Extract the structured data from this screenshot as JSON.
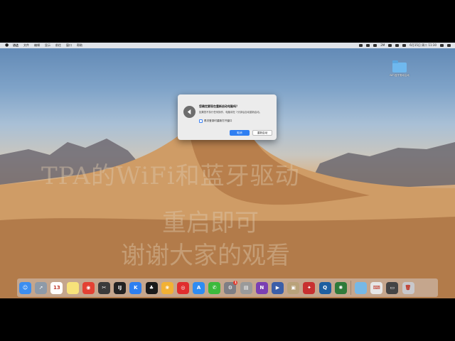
{
  "menubar": {
    "items": [
      "访达",
      "文件",
      "编辑",
      "显示",
      "前往",
      "窗口",
      "帮助"
    ],
    "status_text": [
      "2M",
      "6月15日 周二 11:30"
    ]
  },
  "desktop": {
    "folder_label": "WiFi蓝牙驱动启动"
  },
  "captions": {
    "line1": "TPA的WiFi和蓝牙驱动",
    "line2": "重启即可",
    "line3": "谢谢大家的观看"
  },
  "dialog": {
    "title": "您确定要现在重新启动电脑吗？",
    "message": "如果您不执行任何操作，电脑将在 7分钟后自动重新启动。",
    "checkbox_label": "再次登录时重新打开窗口",
    "primary_button": "取消",
    "secondary_button": "重新启动"
  },
  "dock": {
    "apps": [
      {
        "name": "finder-icon",
        "color": "#3c8ef0",
        "glyph": "☺"
      },
      {
        "name": "launchpad-icon",
        "color": "#8e9aa8",
        "glyph": "➚"
      },
      {
        "name": "calendar-icon",
        "color": "#ffffff",
        "glyph": "13"
      },
      {
        "name": "notes-icon",
        "color": "#f7e27a",
        "glyph": ""
      },
      {
        "name": "chrome-icon",
        "color": "#e34133",
        "glyph": "◉"
      },
      {
        "name": "final-cut-icon",
        "color": "#3a3a3a",
        "glyph": "✂"
      },
      {
        "name": "intellij-icon",
        "color": "#222222",
        "glyph": "IJ"
      },
      {
        "name": "kugou-icon",
        "color": "#2d7ff0",
        "glyph": "K"
      },
      {
        "name": "qq-icon",
        "color": "#1a1a1a",
        "glyph": "♣"
      },
      {
        "name": "photos-icon",
        "color": "#f2b134",
        "glyph": "❀"
      },
      {
        "name": "netease-music-icon",
        "color": "#e02d2d",
        "glyph": "◎"
      },
      {
        "name": "app-store-icon",
        "color": "#2f8cf2",
        "glyph": "A"
      },
      {
        "name": "wechat-icon",
        "color": "#3cba3c",
        "glyph": "✆"
      },
      {
        "name": "system-preferences-icon",
        "color": "#7e7e84",
        "glyph": "⚙"
      },
      {
        "name": "printer-icon",
        "color": "#9a9a9a",
        "glyph": "▤"
      },
      {
        "name": "onenote-icon",
        "color": "#7b3fb3",
        "glyph": "N"
      },
      {
        "name": "keynote-icon",
        "color": "#3b5ea8",
        "glyph": "▶"
      },
      {
        "name": "archive-utility-icon",
        "color": "#b9a27a",
        "glyph": "▣"
      },
      {
        "name": "bartender-icon",
        "color": "#c83030",
        "glyph": "✦"
      },
      {
        "name": "quicktime-icon",
        "color": "#1e5fa0",
        "glyph": "Q"
      },
      {
        "name": "xcode-debug-icon",
        "color": "#2f7a3a",
        "glyph": "✺"
      },
      {
        "name": "downloads-folder-icon",
        "color": "#76b8e6",
        "glyph": ""
      },
      {
        "name": "keyboard-viewer-icon",
        "color": "#e6e6e6",
        "glyph": "⌨"
      },
      {
        "name": "screenshot-stack-icon",
        "color": "#444444",
        "glyph": "▭"
      },
      {
        "name": "trash-icon",
        "color": "#c8c8cc",
        "glyph": "🗑"
      }
    ],
    "badges": {
      "calendar": "",
      "system_preferences": "1"
    }
  }
}
